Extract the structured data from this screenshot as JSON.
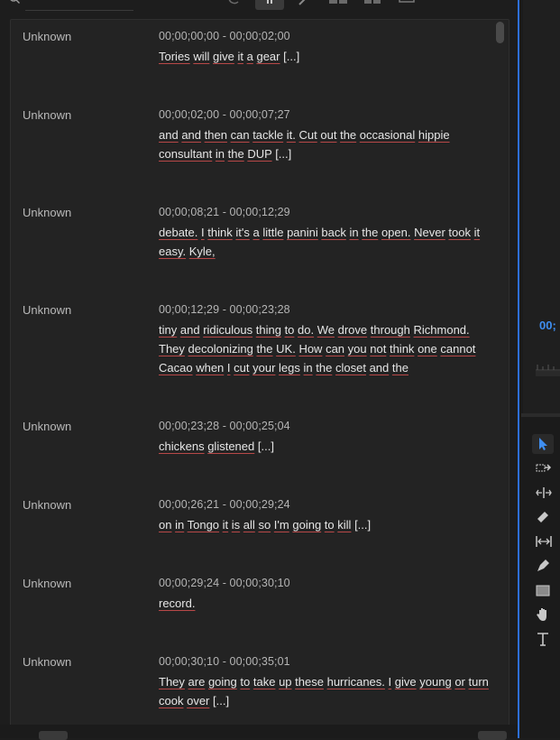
{
  "transcript": [
    {
      "speaker": "Unknown",
      "time": "00;00;00;00 - 00;00;02;00",
      "text": "Tories will give it a gear [...]"
    },
    {
      "speaker": "Unknown",
      "time": "00;00;02;00 - 00;00;07;27",
      "text": "and and then can tackle it. Cut out the occasional hippie consultant in the DUP [...]"
    },
    {
      "speaker": "Unknown",
      "time": "00;00;08;21 - 00;00;12;29",
      "text": "debate. I think it's a little panini back in the open. Never took it easy. Kyle,"
    },
    {
      "speaker": "Unknown",
      "time": "00;00;12;29 - 00;00;23;28",
      "text": "tiny and ridiculous thing to do. We drove through Richmond. They decolonizing the UK. How can you not think one cannot Cacao when I cut your legs in the closet and the"
    },
    {
      "speaker": "Unknown",
      "time": "00;00;23;28 - 00;00;25;04",
      "text": "chickens glistened [...]"
    },
    {
      "speaker": "Unknown",
      "time": "00;00;26;21 - 00;00;29;24",
      "text": "on in Tongo it is all so I'm going to kill [...]"
    },
    {
      "speaker": "Unknown",
      "time": "00;00;29;24 - 00;00;30;10",
      "text": "record."
    },
    {
      "speaker": "Unknown",
      "time": "00;00;30;10 - 00;00;35;01",
      "text": "They are going to take up these hurricanes. I give young or turn cook over [...]"
    }
  ],
  "timecode_readout": "00;",
  "tools": [
    "selection-tool",
    "track-select-tool",
    "ripple-edit-tool",
    "razor-tool",
    "slip-tool",
    "pen-tool",
    "rectangle-tool",
    "hand-tool",
    "type-tool"
  ],
  "colors": {
    "accent": "#2d6fd8",
    "underline": "#b84848",
    "timecode": "#3f8ef0"
  }
}
